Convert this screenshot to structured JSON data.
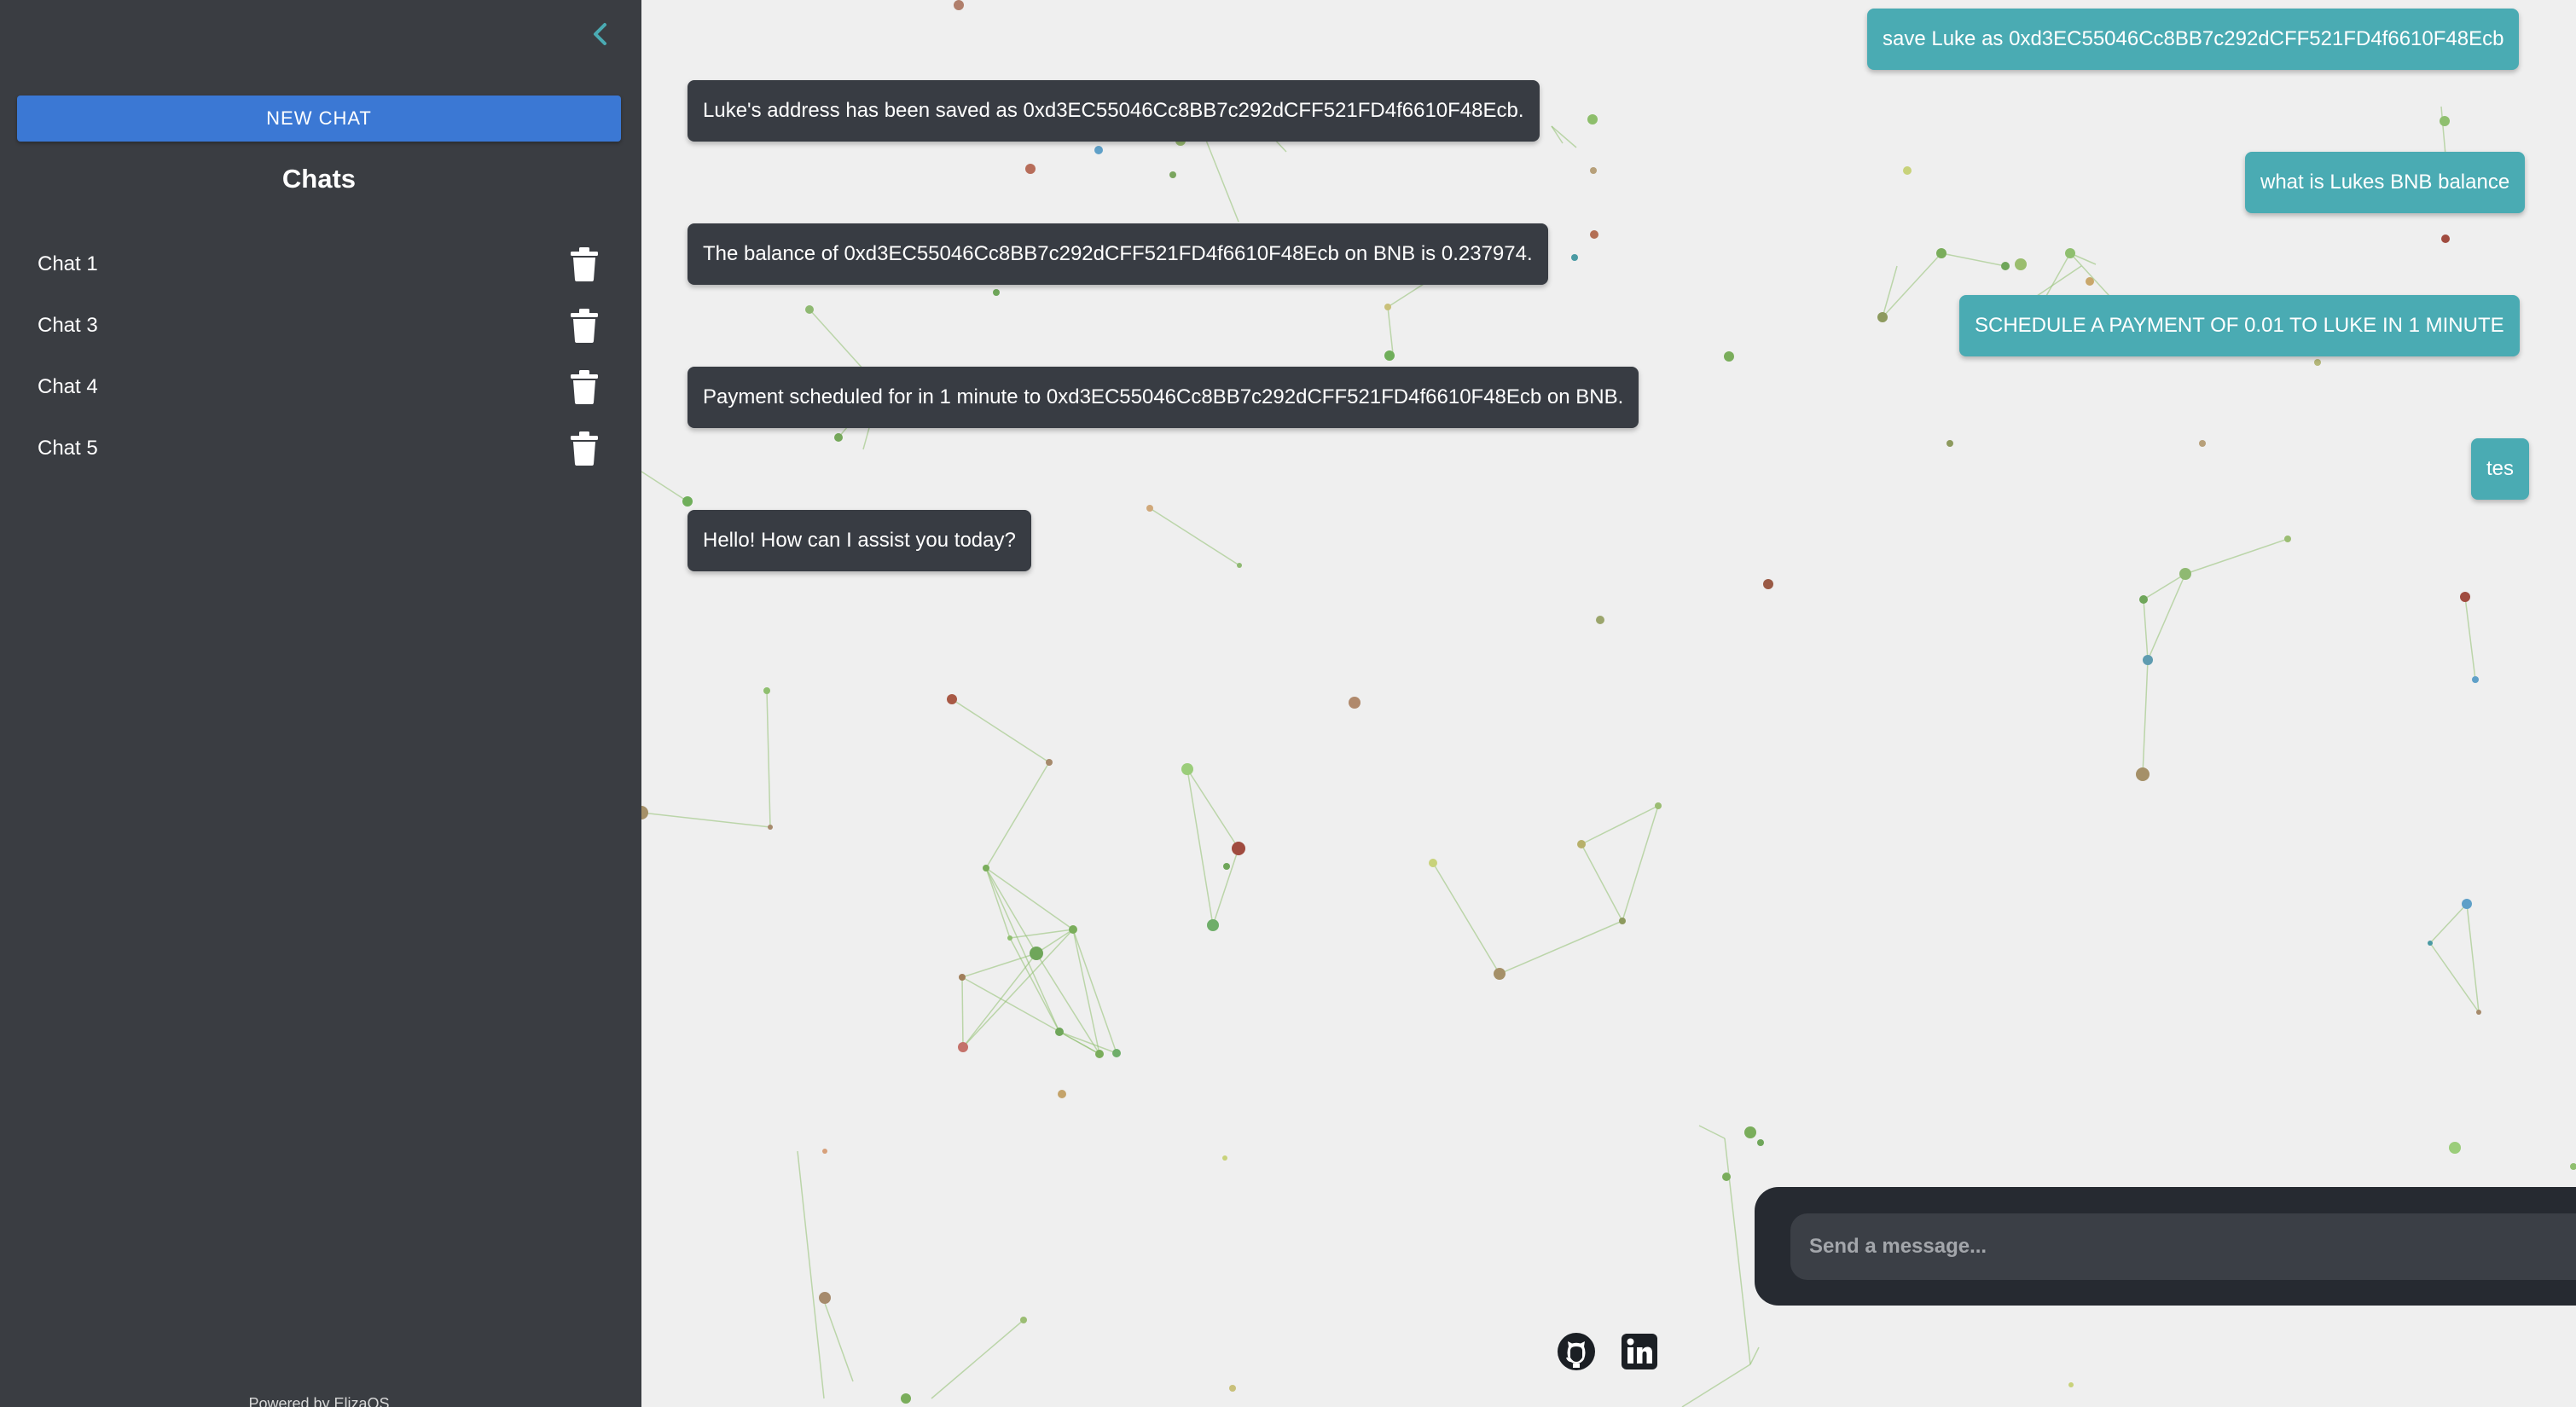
{
  "sidebar": {
    "new_chat_label": "NEW CHAT",
    "chats_title": "Chats",
    "chats": [
      {
        "label": "Chat 1"
      },
      {
        "label": "Chat 3"
      },
      {
        "label": "Chat 4"
      },
      {
        "label": "Chat 5"
      }
    ],
    "powered_by": "Powered by ElizaOS",
    "icons": {
      "collapse": "chevron-left-icon",
      "delete": "trash-icon"
    }
  },
  "messages": {
    "user": [
      "save Luke as 0xd3EC55046Cc8BB7c292dCFF521FD4f6610F48Ecb",
      "what is Lukes BNB balance",
      "SCHEDULE A PAYMENT OF 0.01 TO LUKE IN 1 MINUTE",
      "tes"
    ],
    "bot": [
      "Luke's address has been saved as 0xd3EC55046Cc8BB7c292dCFF521FD4f6610F48Ecb.",
      "The balance of 0xd3EC55046Cc8BB7c292dCFF521FD4f6610F48Ecb on BNB is 0.237974.",
      "Payment scheduled for in 1 minute to 0xd3EC55046Cc8BB7c292dCFF521FD4f6610F48Ecb on BNB.",
      "Hello! How can I assist you today?"
    ]
  },
  "composer": {
    "placeholder": "Send a message...",
    "value": "",
    "send_icon": "send-icon"
  },
  "footer_links": [
    "github-icon",
    "linkedin-icon"
  ],
  "colors": {
    "sidebar_bg": "#3a3d42",
    "page_bg": "#efefef",
    "accent_teal": "#4aabb3",
    "button_blue": "#3b78d4",
    "bot_bubble": "#383c43",
    "input_bar": "#262a31"
  }
}
